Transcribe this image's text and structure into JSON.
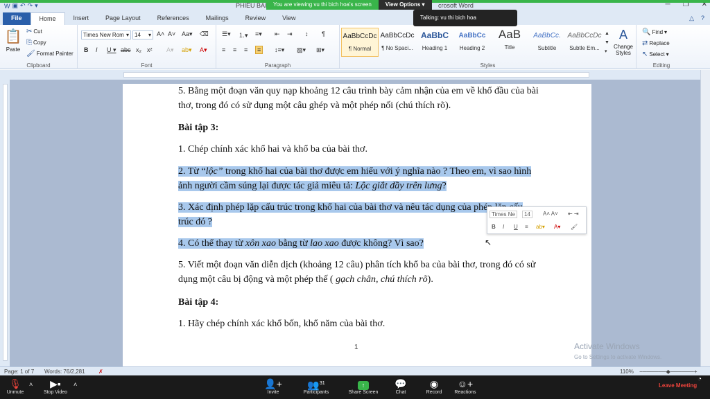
{
  "app": {
    "title_left": "PHIẾU BÀI",
    "title_right": "crosoft Word"
  },
  "zoom_share": {
    "viewing_text": "You are viewing vu thi bich hoa's screen",
    "view_options": "View Options",
    "talking": "Talking: vu thi bich hoa"
  },
  "tabs": [
    "File",
    "Home",
    "Insert",
    "Page Layout",
    "References",
    "Mailings",
    "Review",
    "View"
  ],
  "ribbon": {
    "clipboard": {
      "label": "Clipboard",
      "paste": "Paste",
      "cut": "Cut",
      "copy": "Copy",
      "format_painter": "Format Painter"
    },
    "font": {
      "label": "Font",
      "name": "Times New Rom",
      "size": "14"
    },
    "paragraph": {
      "label": "Paragraph"
    },
    "styles": {
      "label": "Styles",
      "items": [
        {
          "sample": "AaBbCcDc",
          "name": "¶ Normal"
        },
        {
          "sample": "AaBbCcDc",
          "name": "¶ No Spaci..."
        },
        {
          "sample": "AaBbC",
          "name": "Heading 1"
        },
        {
          "sample": "AaBbCc",
          "name": "Heading 2"
        },
        {
          "sample": "AaB",
          "name": "Title"
        },
        {
          "sample": "AaBbCc.",
          "name": "Subtitle"
        },
        {
          "sample": "AaBbCcDc",
          "name": "Subtle Em..."
        }
      ],
      "change_styles": "Change Styles"
    },
    "editing": {
      "label": "Editing",
      "find": "Find",
      "replace": "Replace",
      "select": "Select"
    }
  },
  "document": {
    "p1": "5. Bằng một đoạn văn quy nạp khoảng 12 câu trình bày cảm nhận của em về khổ đầu của bài thơ, trong đó có sử dụng một câu ghép và một phép nối (chú thích rõ).",
    "h3": "Bài tập 3:",
    "p2": "1. Chép chính xác khổ hai và khổ ba của bài thơ.",
    "p3a": " 2. Từ “",
    "p3b": "lộc”",
    "p3c": " trong khổ hai của bài thơ được em hiểu với ý nghĩa nào ? Theo em, vì sao hình ảnh người cầm súng lại được tác giả miêu tả: ",
    "p3d": "Lộc giắt đầy trên lưng",
    "p3e": "?",
    "p4": "3.  Xác định phép lặp cấu trúc trong khổ hai của bài thơ và nêu tác dụng của phép lặp cấu trúc đó ?",
    "p5a": "4. Có thể thay từ ",
    "p5b": "xôn xao",
    "p5c": " bằng từ ",
    "p5d": "lao xao",
    "p5e": " được không? Vì sao?",
    "p6a": "5. Viết một đoạn văn diễn dịch (khoảng 12 câu) phân tích khổ ba của bài thơ, trong đó có sử dụng một câu bị động và một phép thế  ( ",
    "p6b": "gạch chân, chú thích rõ",
    "p6c": ").",
    "h4": "Bài tập 4:",
    "p7": "1. Hãy chép chính xác khổ bốn, khổ năm của bài thơ.",
    "page_number": "1"
  },
  "mini_toolbar": {
    "font": "Times Ne",
    "size": "14"
  },
  "watermark": {
    "line1": "Activate Windows",
    "line2": "Go to Settings to activate Windows."
  },
  "statusbar": {
    "page": "Page: 1 of 7",
    "words": "Words: 76/2,281",
    "zoom": "110%"
  },
  "zoom_controls": {
    "unmute": "Unmute",
    "stop_video": "Stop Video",
    "invite": "Invite",
    "participants": "Participants",
    "participants_count": "31",
    "share_screen": "Share Screen",
    "chat": "Chat",
    "record": "Record",
    "reactions": "Reactions",
    "leave": "Leave Meeting"
  }
}
